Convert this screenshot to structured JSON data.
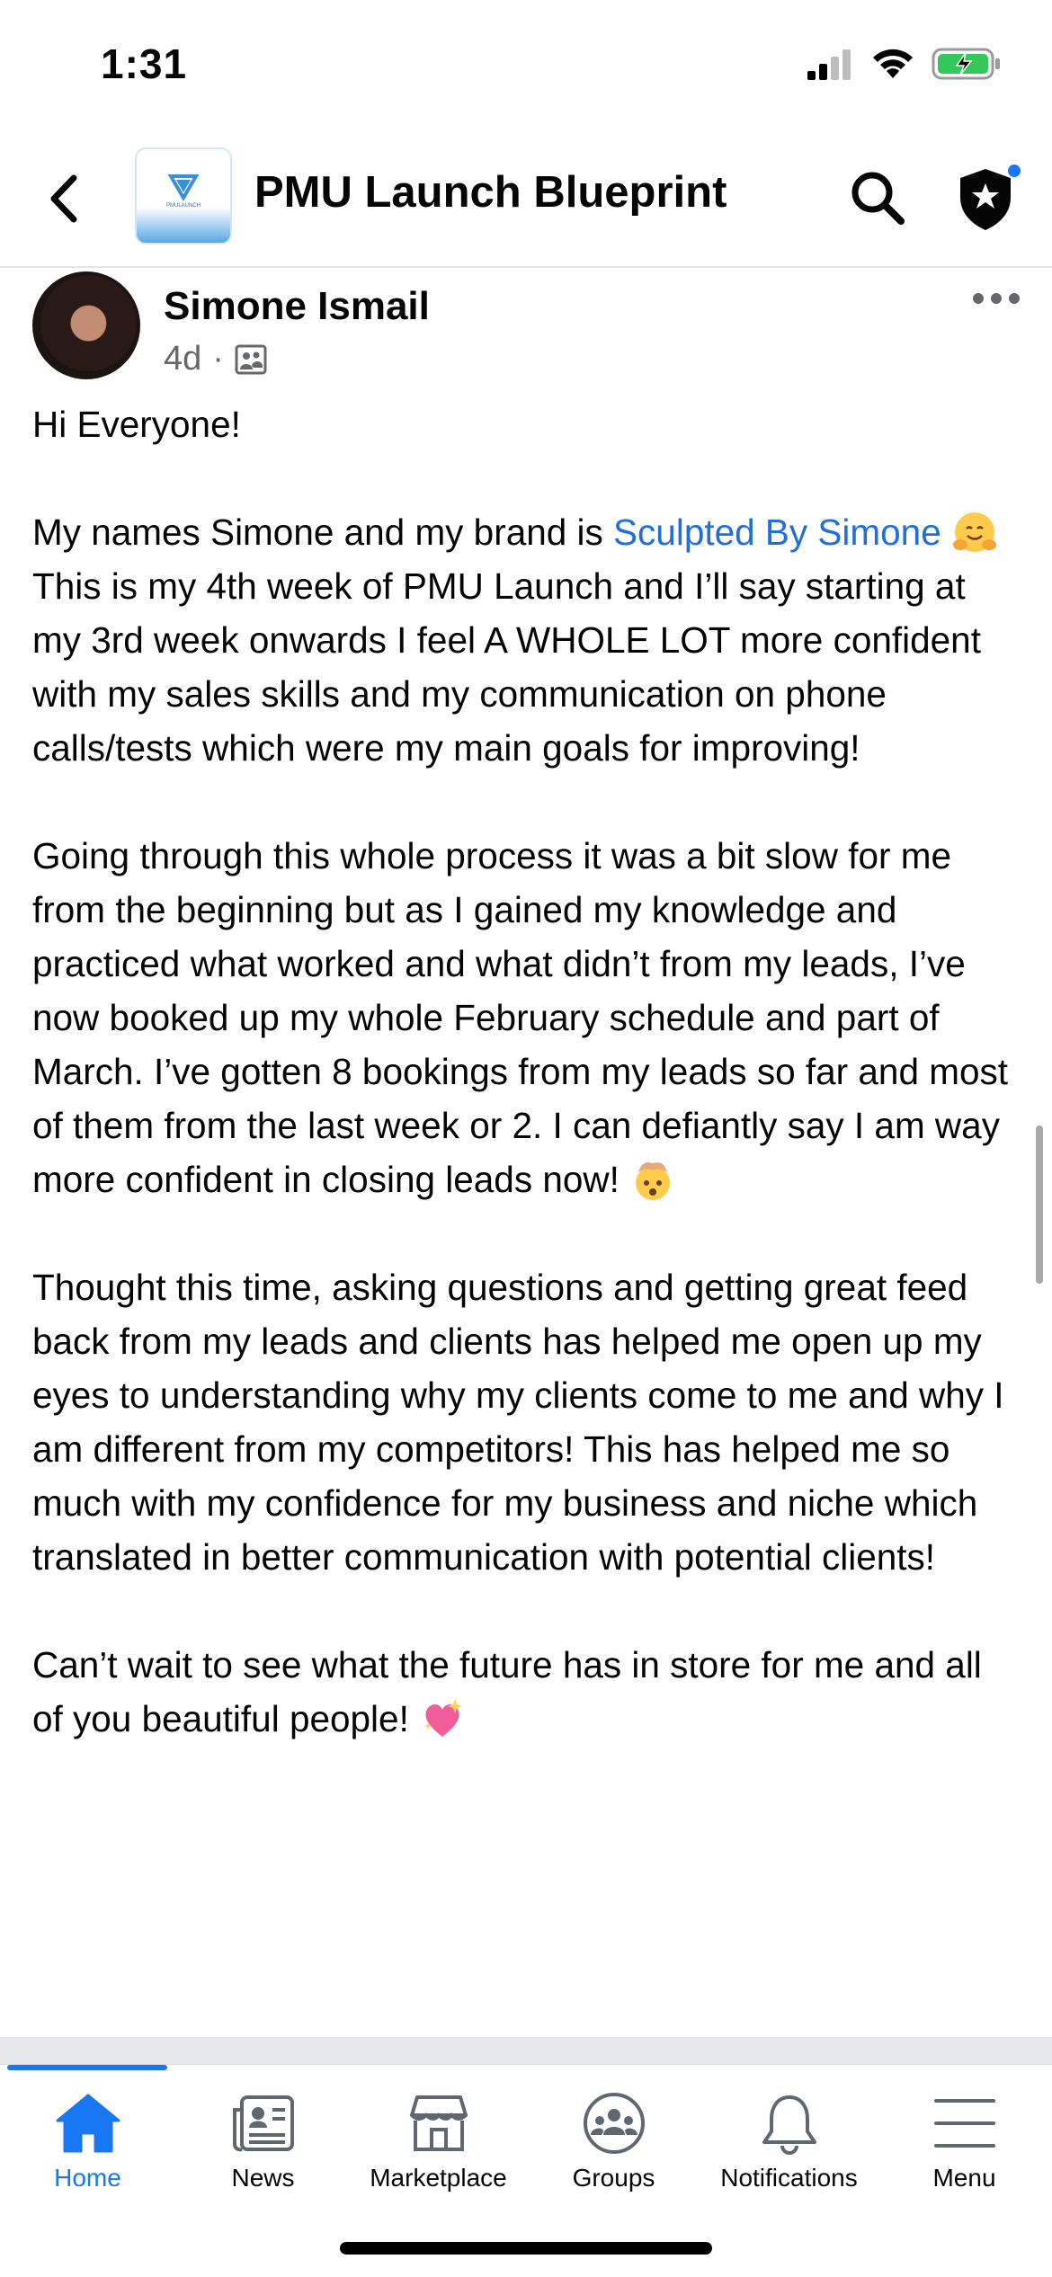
{
  "status_bar": {
    "time": "1:31"
  },
  "header": {
    "group_name": "PMU Launch Blueprint",
    "logo_text": "PMULAUNCH"
  },
  "post": {
    "author": "Simone Ismail",
    "time_ago": "4d",
    "separator": "·",
    "paragraphs": {
      "p1": "Hi Everyone!",
      "p2_before": "My names Simone and my brand is ",
      "p2_link": "Sculpted By Simone",
      "p2_after": " This is my 4th week of PMU Launch and I’ll say starting at my 3rd week onwards I feel A WHOLE LOT more confident with my sales skills and my communication on phone calls/tests which were my main goals for improving!",
      "p3": "Going through this whole process it was a bit slow for me from the beginning but as I gained my knowledge and practiced what worked and what didn’t from my leads, I’ve now booked up my whole February schedule and part of March. I’ve gotten 8 bookings from my leads so far and most of them from the last week or 2. I can defiantly say I am way more confident in closing leads now!",
      "p4": "Thought this time, asking questions and getting great feed back from my leads and clients has helped me open up my eyes to understanding why my clients come to me and why I am different from my competitors! This has helped me so much with my confidence for my business and niche which translated in better communication with potential clients!",
      "p5": "Can’t wait to see what the future has in store for me and all of you beautiful people!"
    },
    "emojis": [
      "hugging-face",
      "exploding-head",
      "sparkling-heart"
    ]
  },
  "tab_bar": {
    "tabs": [
      {
        "label": "Home",
        "icon": "home-icon",
        "active": true
      },
      {
        "label": "News",
        "icon": "news-icon",
        "active": false
      },
      {
        "label": "Marketplace",
        "icon": "marketplace-icon",
        "active": false
      },
      {
        "label": "Groups",
        "icon": "groups-icon",
        "active": false
      },
      {
        "label": "Notifications",
        "icon": "bell-icon",
        "active": false
      },
      {
        "label": "Menu",
        "icon": "menu-icon",
        "active": false
      }
    ]
  },
  "colors": {
    "accent": "#1877f2",
    "link": "#216fdb",
    "secondary_text": "#65676b"
  }
}
